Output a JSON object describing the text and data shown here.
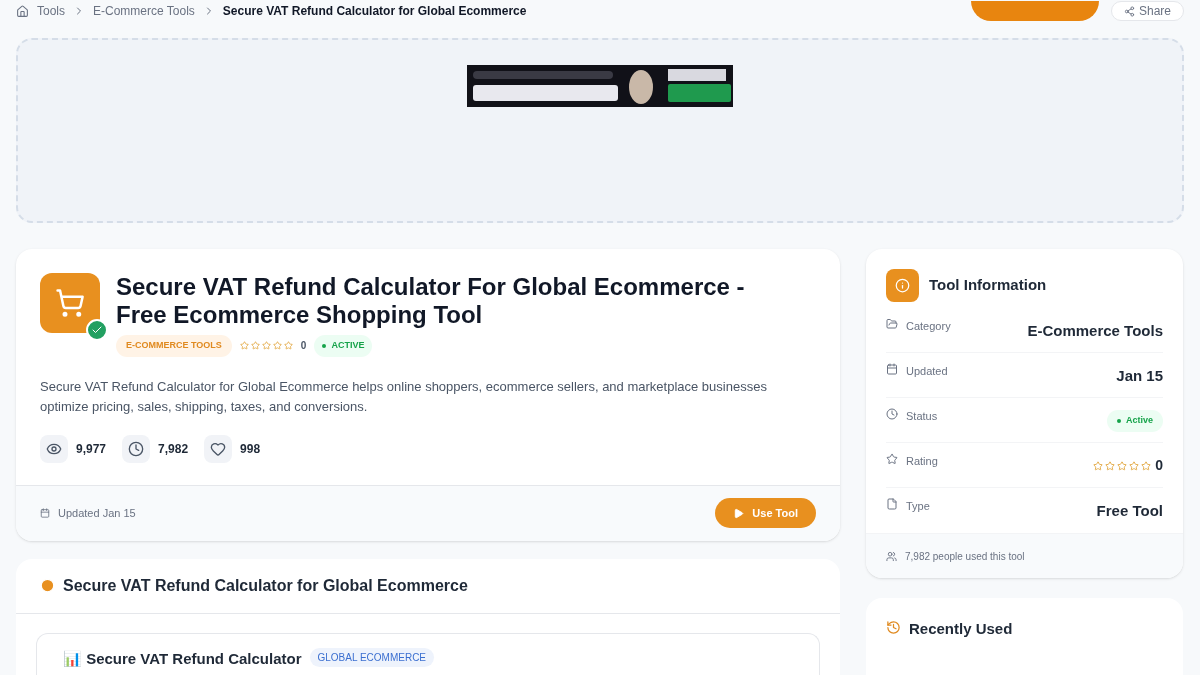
{
  "breadcrumb": {
    "items": [
      {
        "label": "Tools",
        "kind": "home"
      },
      {
        "label": "E-Commerce Tools",
        "kind": "link"
      },
      {
        "label": "Secure VAT Refund Calculator for Global Ecommerce",
        "kind": "current"
      }
    ]
  },
  "header": {
    "share_label": "Share"
  },
  "tool": {
    "title": "Secure VAT Refund Calculator For Global Ecommerce - Free Ecommerce Shopping Tool",
    "verified": true,
    "category": "E-COMMERCE TOOLS",
    "stars": 0,
    "rating": "0",
    "status": "ACTIVE",
    "description": "Secure VAT Refund Calculator for Global Ecommerce helps online shoppers, ecommerce sellers, and marketplace businesses optimize pricing, sales, shipping, taxes, and conversions.",
    "stats": [
      {
        "kind": "views",
        "value": "9,977"
      },
      {
        "kind": "uses",
        "value": "7,982"
      },
      {
        "kind": "likes",
        "value": "998"
      }
    ],
    "updated": "Updated Jan 15",
    "button": "Use Tool"
  },
  "section": {
    "title": "Secure VAT Refund Calculator for Global Ecommerce",
    "inner_title": "📊 Secure VAT Refund Calculator",
    "inner_tag": "GLOBAL ECOMMERCE"
  },
  "info": {
    "title": "Tool Information",
    "rows": [
      {
        "kind": "text",
        "label": "Category",
        "value": "E-Commerce Tools"
      },
      {
        "kind": "text",
        "label": "Updated",
        "value": "Jan 15"
      },
      {
        "kind": "badge",
        "label": "Status",
        "value": "Active"
      },
      {
        "kind": "stars",
        "label": "Rating",
        "stars": 0,
        "value": "0"
      },
      {
        "kind": "text",
        "label": "Type",
        "value": "Free Tool"
      }
    ],
    "footer": "7,982 people used this tool"
  },
  "recent": {
    "title": "Recently Used"
  }
}
